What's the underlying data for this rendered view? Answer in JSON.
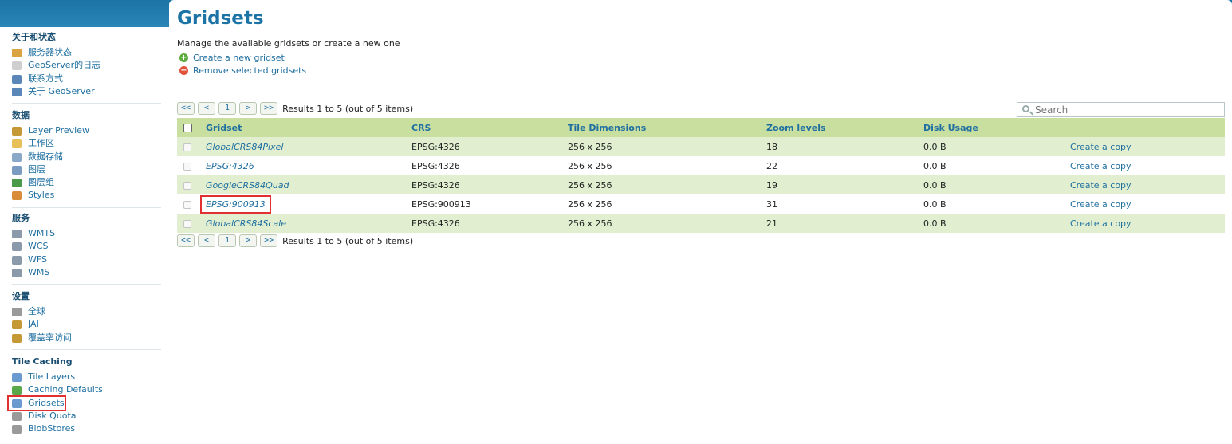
{
  "sidebar": {
    "sections": [
      {
        "title": "关于和状态",
        "items": [
          {
            "label": "服务器状态",
            "icon": "server-status-icon",
            "color": "#d9a441"
          },
          {
            "label": "GeoServer的日志",
            "icon": "log-icon",
            "color": "#cfcfcf"
          },
          {
            "label": "联系方式",
            "icon": "contact-icon",
            "color": "#5a87b8"
          },
          {
            "label": "关于 GeoServer",
            "icon": "about-icon",
            "color": "#5a87b8"
          }
        ]
      },
      {
        "title": "数据",
        "items": [
          {
            "label": "Layer Preview",
            "icon": "layer-preview-icon",
            "color": "#c59a36"
          },
          {
            "label": "工作区",
            "icon": "workspace-icon",
            "color": "#e8c05a"
          },
          {
            "label": "数据存储",
            "icon": "store-icon",
            "color": "#8aa8c8"
          },
          {
            "label": "图层",
            "icon": "layer-icon",
            "color": "#7a9cc0"
          },
          {
            "label": "图层组",
            "icon": "layer-group-icon",
            "color": "#4a9a4a"
          },
          {
            "label": "Styles",
            "icon": "styles-icon",
            "color": "#d98c3a"
          }
        ]
      },
      {
        "title": "服务",
        "items": [
          {
            "label": "WMTS",
            "icon": "wmts-icon",
            "color": "#8a9aaa"
          },
          {
            "label": "WCS",
            "icon": "wcs-icon",
            "color": "#8a9aaa"
          },
          {
            "label": "WFS",
            "icon": "wfs-icon",
            "color": "#8a9aaa"
          },
          {
            "label": "WMS",
            "icon": "wms-icon",
            "color": "#8a9aaa"
          }
        ]
      },
      {
        "title": "设置",
        "items": [
          {
            "label": "全球",
            "icon": "global-settings-icon",
            "color": "#9a9a9a"
          },
          {
            "label": "JAI",
            "icon": "jai-icon",
            "color": "#c59a36"
          },
          {
            "label": "覆盖率访问",
            "icon": "coverage-access-icon",
            "color": "#c59a36"
          }
        ]
      },
      {
        "title": "Tile Caching",
        "items": [
          {
            "label": "Tile Layers",
            "icon": "tile-layers-icon",
            "color": "#6a9ad0"
          },
          {
            "label": "Caching Defaults",
            "icon": "caching-defaults-icon",
            "color": "#5aa84a"
          },
          {
            "label": "Gridsets",
            "icon": "gridsets-icon",
            "color": "#6a9ad0",
            "active": true
          },
          {
            "label": "Disk Quota",
            "icon": "disk-quota-icon",
            "color": "#9a9a9a"
          },
          {
            "label": "BlobStores",
            "icon": "blobstores-icon",
            "color": "#9a9a9a"
          }
        ]
      }
    ]
  },
  "main": {
    "title": "Gridsets",
    "description": "Manage the available gridsets or create a new one",
    "create_label": "Create a new gridset",
    "remove_label": "Remove selected gridsets",
    "pager": {
      "first": "<<",
      "prev": "<",
      "page": "1",
      "next": ">",
      "last": ">>",
      "results": "Results 1 to 5 (out of 5 items)"
    },
    "search_placeholder": "Search",
    "columns": [
      "Gridset",
      "CRS",
      "Tile Dimensions",
      "Zoom levels",
      "Disk Usage"
    ],
    "rows": [
      {
        "name": "GlobalCRS84Pixel",
        "crs": "EPSG:4326",
        "dims": "256 x 256",
        "zoom": "18",
        "disk": "0.0 B",
        "action": "Create a copy"
      },
      {
        "name": "EPSG:4326",
        "crs": "EPSG:4326",
        "dims": "256 x 256",
        "zoom": "22",
        "disk": "0.0 B",
        "action": "Create a copy"
      },
      {
        "name": "GoogleCRS84Quad",
        "crs": "EPSG:4326",
        "dims": "256 x 256",
        "zoom": "19",
        "disk": "0.0 B",
        "action": "Create a copy"
      },
      {
        "name": "EPSG:900913",
        "crs": "EPSG:900913",
        "dims": "256 x 256",
        "zoom": "31",
        "disk": "0.0 B",
        "action": "Create a copy",
        "highlighted": true
      },
      {
        "name": "GlobalCRS84Scale",
        "crs": "EPSG:4326",
        "dims": "256 x 256",
        "zoom": "21",
        "disk": "0.0 B",
        "action": "Create a copy"
      }
    ]
  }
}
